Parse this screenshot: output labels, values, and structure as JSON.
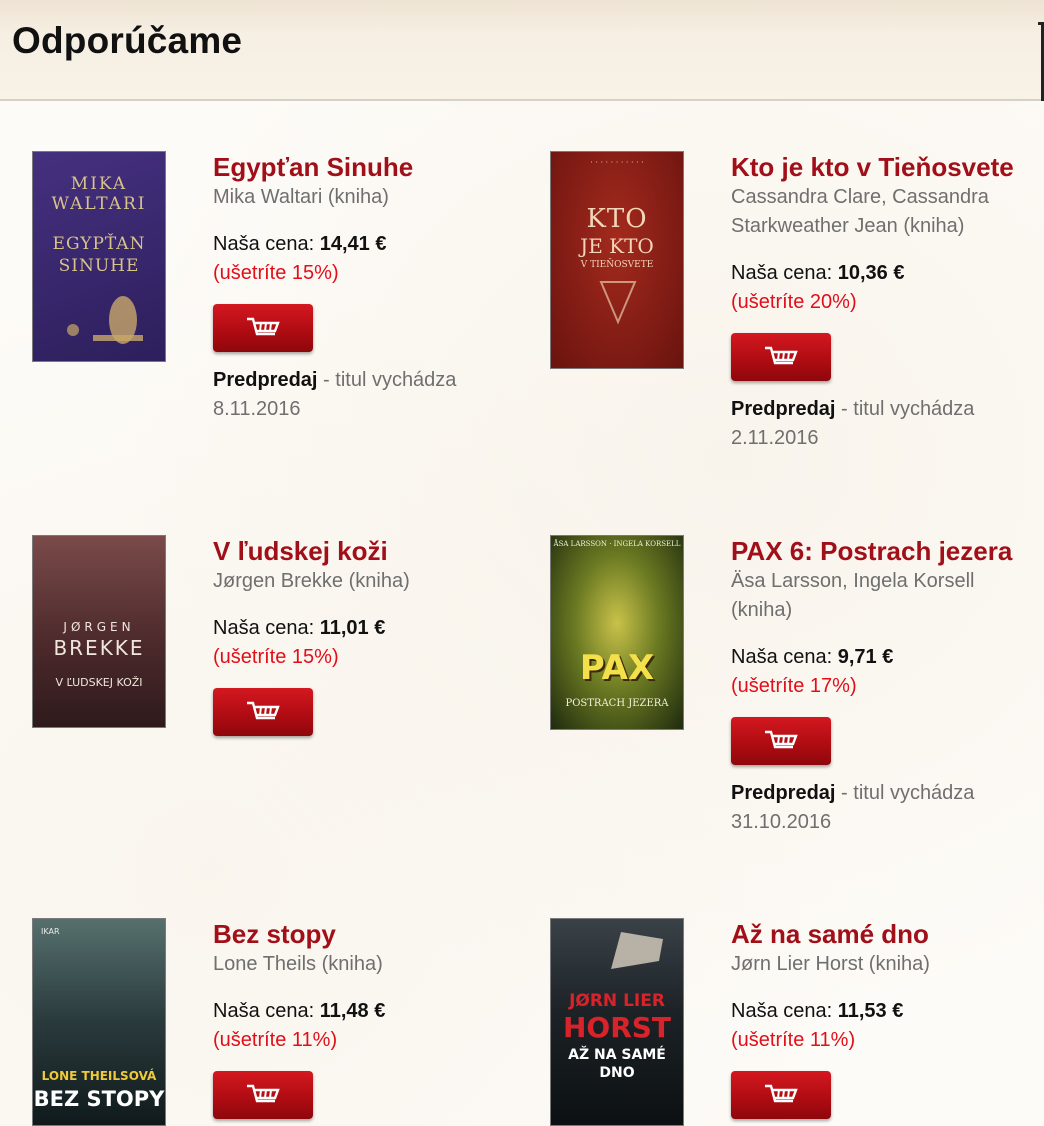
{
  "header": {
    "title": "Odporúčame"
  },
  "labels": {
    "price_prefix": "Naša cena: ",
    "preorder_bold": "Predpredaj",
    "preorder_rest": " - titul vychádza"
  },
  "books": [
    {
      "title": "Egypťan Sinuhe",
      "author": "Mika Waltari (kniha)",
      "price": "14,41 €",
      "savings": "(ušetríte 15%)",
      "release_date": "8.11.2016",
      "cover": {
        "line1": "MIKA",
        "line2": "WALTARI",
        "line3": "EGYPŤAN",
        "line4": "SINUHE",
        "bg": "#3d2a78"
      }
    },
    {
      "title": "Kto je kto v Tieňosvete",
      "author": "Cassandra Clare, Cassandra Starkweather Jean (kniha)",
      "price": "10,36 €",
      "savings": "(ušetríte 20%)",
      "release_date": "2.11.2016",
      "cover": {
        "line1": "KTO",
        "line2": "JE KTO",
        "line3": "V TIEŇOSVETE",
        "bg": "#8a1a14"
      }
    },
    {
      "title": "V ľudskej koži",
      "author": "Jørgen Brekke (kniha)",
      "price": "11,01 €",
      "savings": "(ušetríte 15%)",
      "release_date": "",
      "cover": {
        "line1": "JØRGEN",
        "line2": "BREKKE",
        "line3": "V ĽUDSKEJ KOŽI",
        "bg": "#4a2a2a"
      }
    },
    {
      "title": "PAX 6: Postrach jezera",
      "author": "Äsa Larsson, Ingela Korsell (kniha)",
      "price": "9,71 €",
      "savings": "(ušetríte 17%)",
      "release_date": "31.10.2016",
      "cover": {
        "line1": "ÅSA LARSSON · INGELA KORSELL",
        "line2": "PAX",
        "line3": "POSTRACH JEZERA",
        "bg": "#2a3a14"
      }
    },
    {
      "title": "Bez stopy",
      "author": "Lone Theils (kniha)",
      "price": "11,48 €",
      "savings": "(ušetríte 11%)",
      "release_date": "",
      "cover": {
        "line1": "IKAR",
        "line2": "LONE THEILSOVÁ",
        "line3": "BEZ STOPY",
        "bg": "#1c2a2e"
      }
    },
    {
      "title": "Až na samé dno",
      "author": "Jørn Lier Horst (kniha)",
      "price": "11,53 €",
      "savings": "(ušetríte 11%)",
      "release_date": "",
      "cover": {
        "line1": "JØRN LIER",
        "line2": "HORST",
        "line3": "AŽ NA SAMÉ",
        "line4": "DNO",
        "bg": "#15191d"
      }
    }
  ],
  "icons": {
    "cart": "shopping-cart-icon"
  },
  "colors": {
    "title": "#a10f18",
    "savings": "#e20e1a",
    "button": "#b10c13"
  }
}
